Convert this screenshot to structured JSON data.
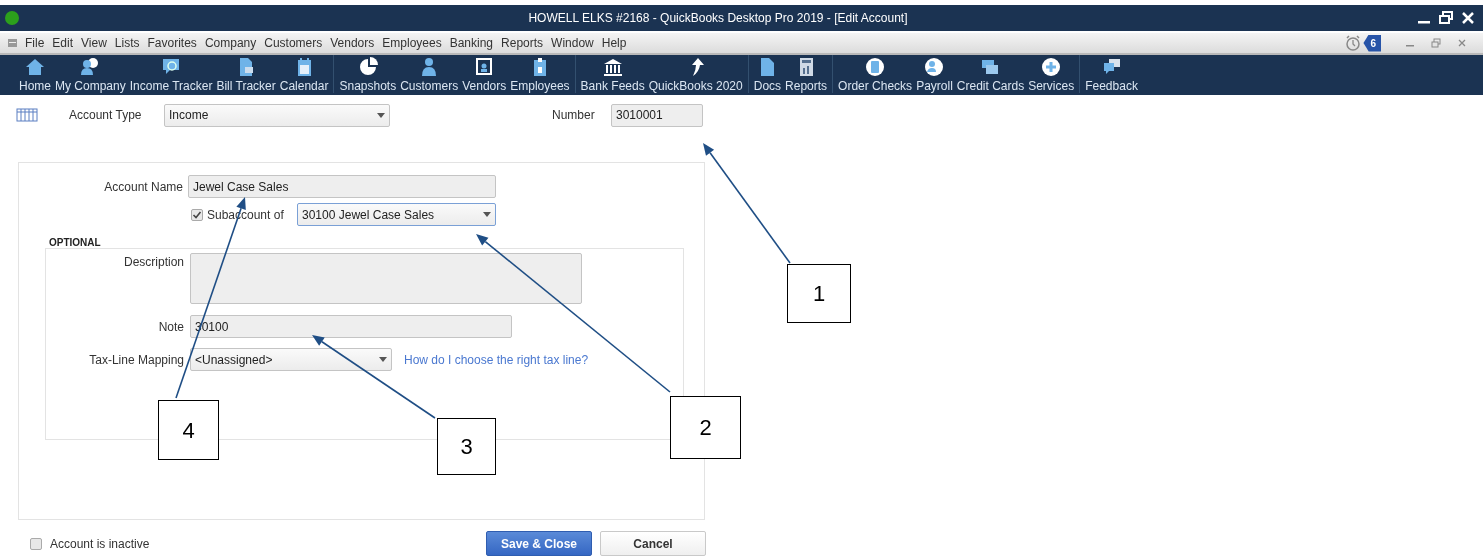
{
  "window": {
    "title": "HOWELL ELKS #2168  - QuickBooks Desktop Pro 2019 - [Edit Account]"
  },
  "menu": [
    "File",
    "Edit",
    "View",
    "Lists",
    "Favorites",
    "Company",
    "Customers",
    "Vendors",
    "Employees",
    "Banking",
    "Reports",
    "Window",
    "Help"
  ],
  "reminder_badge": "6",
  "toolbar": {
    "groups": [
      {
        "items": [
          "Home",
          "My Company",
          "Income Tracker",
          "Bill Tracker",
          "Calendar"
        ]
      },
      {
        "items": [
          "Snapshots",
          "Customers",
          "Vendors",
          "Employees"
        ]
      },
      {
        "items": [
          "Bank Feeds",
          "QuickBooks 2020"
        ]
      },
      {
        "items": [
          "Docs",
          "Reports"
        ]
      },
      {
        "items": [
          "Order Checks",
          "Payroll",
          "Credit Cards",
          "Services"
        ]
      },
      {
        "items": [
          "Feedback"
        ]
      }
    ]
  },
  "form": {
    "account_type": {
      "label": "Account Type",
      "value": "Income"
    },
    "number": {
      "label": "Number",
      "value": "3010001"
    },
    "account_name": {
      "label": "Account Name",
      "value": "Jewel Case Sales"
    },
    "subaccount": {
      "label": "Subaccount of",
      "checked": true,
      "value": "30100 Jewel Case Sales"
    },
    "optional_heading": "OPTIONAL",
    "description": {
      "label": "Description"
    },
    "note": {
      "label": "Note",
      "value": "30100"
    },
    "tax_line": {
      "label": "Tax-Line Mapping",
      "value": "<Unassigned>",
      "help_link": "How do I choose the right tax line?"
    },
    "inactive": {
      "label": "Account is inactive",
      "checked": false
    }
  },
  "buttons": [
    {
      "label": "Save & Close",
      "primary": true
    },
    {
      "label": "Cancel",
      "primary": false
    }
  ],
  "callouts": [
    {
      "label": "1"
    },
    {
      "label": "2"
    },
    {
      "label": "3"
    },
    {
      "label": "4"
    }
  ]
}
